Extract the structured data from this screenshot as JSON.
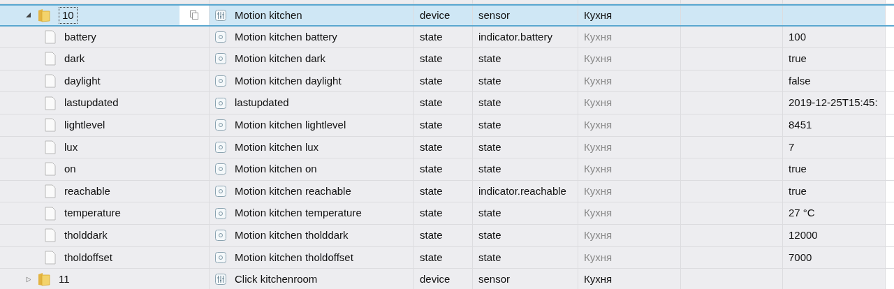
{
  "tree": [
    {
      "name": "10",
      "kind": "folder",
      "expanded": true,
      "selected": true,
      "title": "Motion kitchen",
      "type": "device",
      "role": "sensor",
      "room": "Кухня",
      "children": [
        {
          "name": "battery",
          "kind": "file",
          "selected": false,
          "title": "Motion kitchen battery",
          "type": "state",
          "role": "indicator.battery",
          "room": "Кухня",
          "value": "100"
        },
        {
          "name": "dark",
          "kind": "file",
          "selected": false,
          "title": "Motion kitchen dark",
          "type": "state",
          "role": "state",
          "room": "Кухня",
          "value": "true"
        },
        {
          "name": "daylight",
          "kind": "file",
          "selected": false,
          "title": "Motion kitchen daylight",
          "type": "state",
          "role": "state",
          "room": "Кухня",
          "value": "false"
        },
        {
          "name": "lastupdated",
          "kind": "file",
          "selected": false,
          "title": "lastupdated",
          "type": "state",
          "role": "state",
          "room": "Кухня",
          "value": "2019-12-25T15:45:"
        },
        {
          "name": "lightlevel",
          "kind": "file",
          "selected": false,
          "title": "Motion kitchen lightlevel",
          "type": "state",
          "role": "state",
          "room": "Кухня",
          "value": "8451"
        },
        {
          "name": "lux",
          "kind": "file",
          "selected": false,
          "title": "Motion kitchen lux",
          "type": "state",
          "role": "state",
          "room": "Кухня",
          "value": "7"
        },
        {
          "name": "on",
          "kind": "file",
          "selected": false,
          "title": "Motion kitchen on",
          "type": "state",
          "role": "state",
          "room": "Кухня",
          "value": "true"
        },
        {
          "name": "reachable",
          "kind": "file",
          "selected": false,
          "title": "Motion kitchen reachable",
          "type": "state",
          "role": "indicator.reachable",
          "room": "Кухня",
          "value": "true"
        },
        {
          "name": "temperature",
          "kind": "file",
          "selected": false,
          "title": "Motion kitchen temperature",
          "type": "state",
          "role": "state",
          "room": "Кухня",
          "value": "27 °C"
        },
        {
          "name": "tholddark",
          "kind": "file",
          "selected": false,
          "title": "Motion kitchen tholddark",
          "type": "state",
          "role": "state",
          "room": "Кухня",
          "value": "12000"
        },
        {
          "name": "tholdoffset",
          "kind": "file",
          "selected": false,
          "title": "Motion kitchen tholdoffset",
          "type": "state",
          "role": "state",
          "room": "Кухня",
          "value": "7000"
        }
      ]
    },
    {
      "name": "11",
      "kind": "folder",
      "expanded": false,
      "selected": false,
      "title": "Click kitchenroom",
      "type": "device",
      "role": "sensor",
      "room": "Кухня"
    }
  ]
}
